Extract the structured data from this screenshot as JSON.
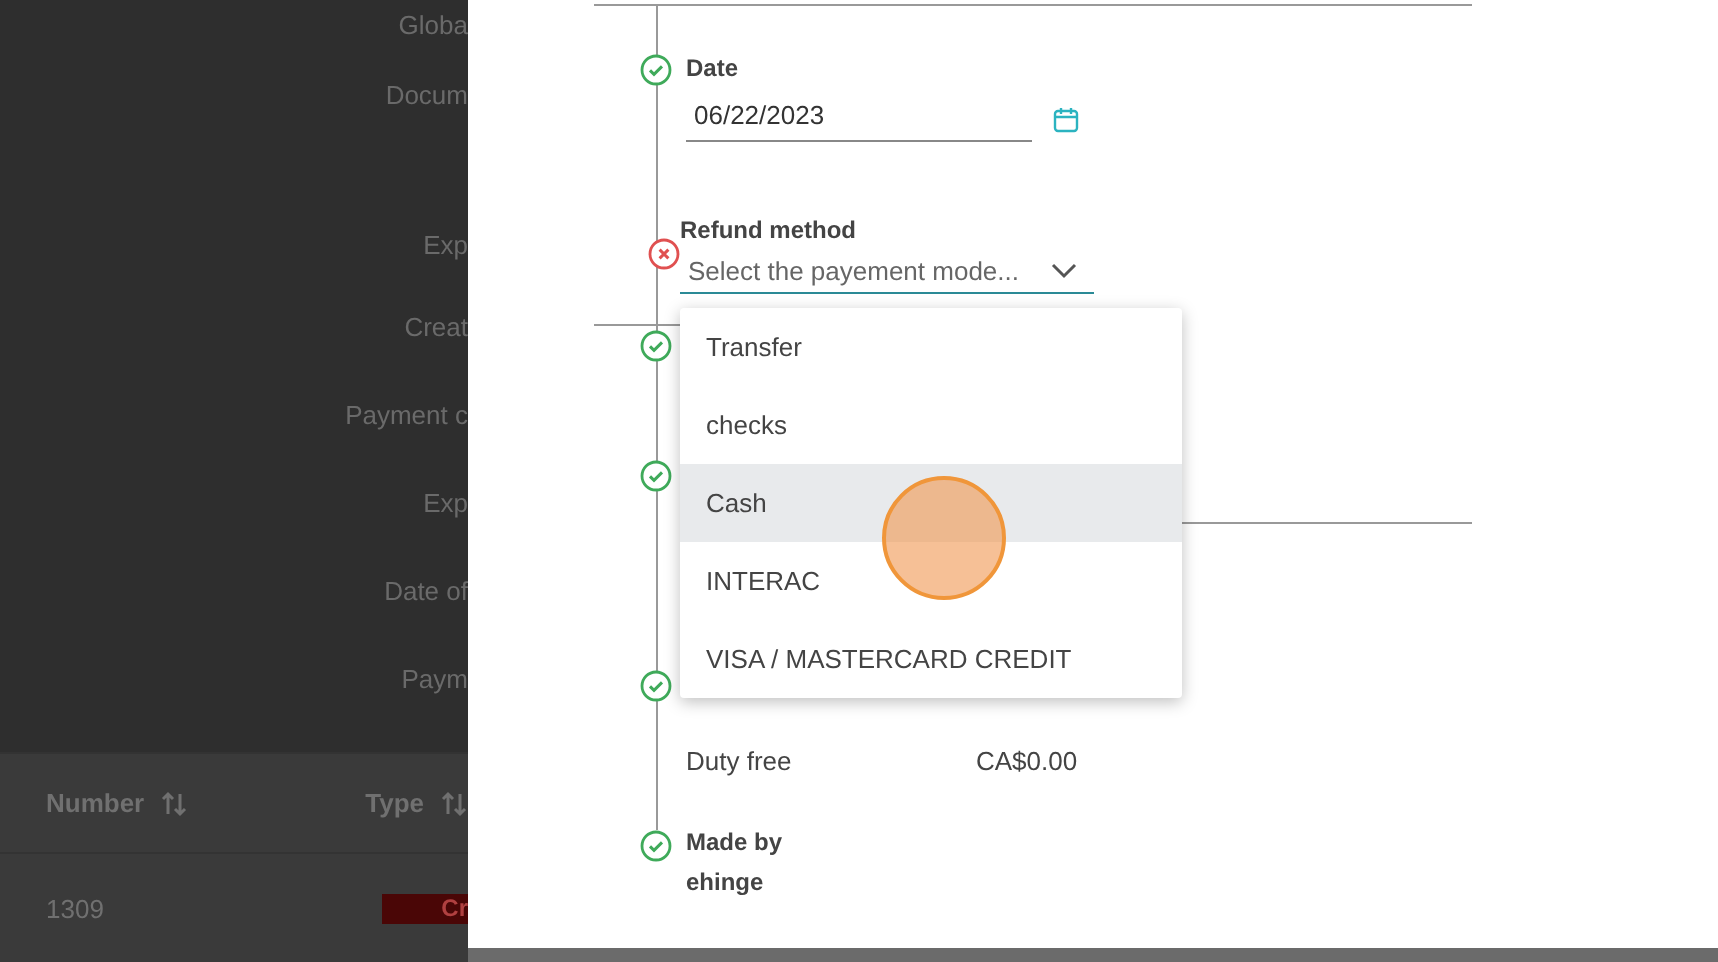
{
  "background": {
    "labels": [
      "Globa",
      "Docum",
      "Exp",
      "Creat",
      "Payment c",
      "Exp",
      "Date of",
      "Paym"
    ],
    "table": {
      "columns": [
        {
          "label": "Number"
        },
        {
          "label": "Type"
        }
      ],
      "rows": [
        {
          "number": "1309",
          "type": "Cr"
        }
      ]
    }
  },
  "panel": {
    "steps": [
      {
        "kind": "date",
        "valid": true,
        "label": "Date",
        "value": "06/22/2023"
      },
      {
        "kind": "select",
        "valid": false,
        "label": "Refund method",
        "placeholder": "Select the payement mode...",
        "expanded": true,
        "options": [
          {
            "label": "Transfer",
            "selected": false
          },
          {
            "label": "checks",
            "selected": false
          },
          {
            "label": "Cash",
            "selected": true
          },
          {
            "label": "INTERAC",
            "selected": false
          },
          {
            "label": "VISA / MASTERCARD CREDIT",
            "selected": false
          }
        ]
      },
      {
        "kind": "blank",
        "valid": true
      },
      {
        "kind": "blank",
        "valid": true
      },
      {
        "kind": "amount",
        "valid": true,
        "label": "Duty free",
        "value": "CA$0.00"
      },
      {
        "kind": "person",
        "valid": true,
        "label": "Made by",
        "value": "ehinge"
      }
    ]
  }
}
